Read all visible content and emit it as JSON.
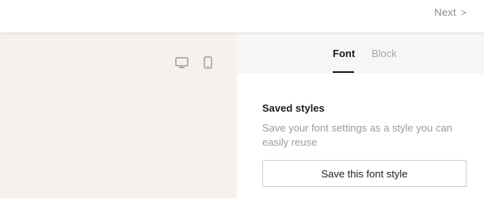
{
  "header": {
    "next_label": "Next",
    "next_chevron": ">"
  },
  "preview": {
    "background": "#f4f1ee",
    "device_toggles": [
      {
        "icon": "desktop-icon"
      },
      {
        "icon": "mobile-icon"
      }
    ]
  },
  "panel": {
    "tabs": [
      {
        "label": "Font",
        "active": true
      },
      {
        "label": "Block",
        "active": false
      }
    ],
    "saved_styles": {
      "heading": "Saved styles",
      "description": "Save your font settings as a style you can easily reuse",
      "button_label": "Save this font style"
    }
  }
}
